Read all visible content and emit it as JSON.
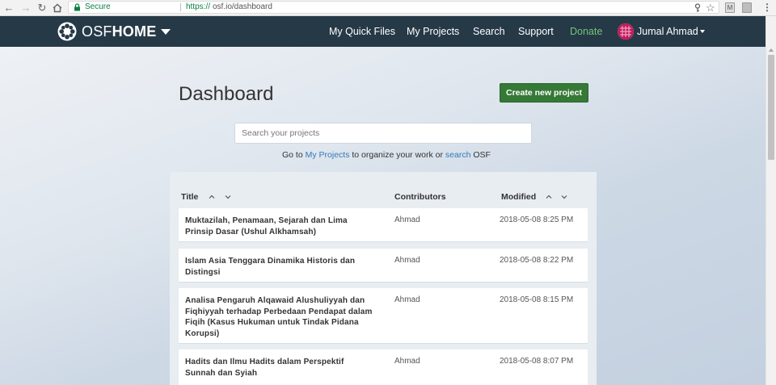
{
  "browser": {
    "secure_label": "Secure",
    "url_scheme": "https://",
    "url_rest": "osf.io/dashboard",
    "extension_label": "M"
  },
  "navbar": {
    "brand_light": "OSF",
    "brand_bold": "HOME",
    "links": [
      "My Quick Files",
      "My Projects",
      "Search",
      "Support",
      "Donate"
    ],
    "user_name": "Jumal Ahmad",
    "donate_color": "#74c476",
    "background_color": "#263947"
  },
  "dashboard": {
    "title": "Dashboard",
    "create_button": "Create new project",
    "search_placeholder": "Search your projects",
    "hint": {
      "before": "Go to ",
      "link1": "My Projects",
      "middle": " to organize your work or ",
      "link2": "search",
      "after": " OSF"
    }
  },
  "table": {
    "columns": [
      "Title",
      "Contributors",
      "Modified"
    ],
    "rows": [
      {
        "title": "Muktazilah, Penamaan, Sejarah dan Lima Prinsip Dasar (Ushul Alkhamsah)",
        "contributors": "Ahmad",
        "modified": "2018-05-08 8:25 PM"
      },
      {
        "title": "Islam Asia Tenggara Dinamika Historis dan Distingsi",
        "contributors": "Ahmad",
        "modified": "2018-05-08 8:22 PM"
      },
      {
        "title": "Analisa Pengaruh Alqawaid Alushuliyyah dan Fiqhiyyah terhadap Perbedaan Pendapat dalam Fiqih (Kasus Hukuman untuk Tindak Pidana Korupsi)",
        "contributors": "Ahmad",
        "modified": "2018-05-08 8:15 PM"
      },
      {
        "title": "Hadits dan Ilmu Hadits dalam Perspektif Sunnah dan Syiah",
        "contributors": "Ahmad",
        "modified": "2018-05-08 8:07 PM"
      }
    ]
  },
  "colors": {
    "accent_button": "#357936",
    "link": "#337ab7"
  }
}
